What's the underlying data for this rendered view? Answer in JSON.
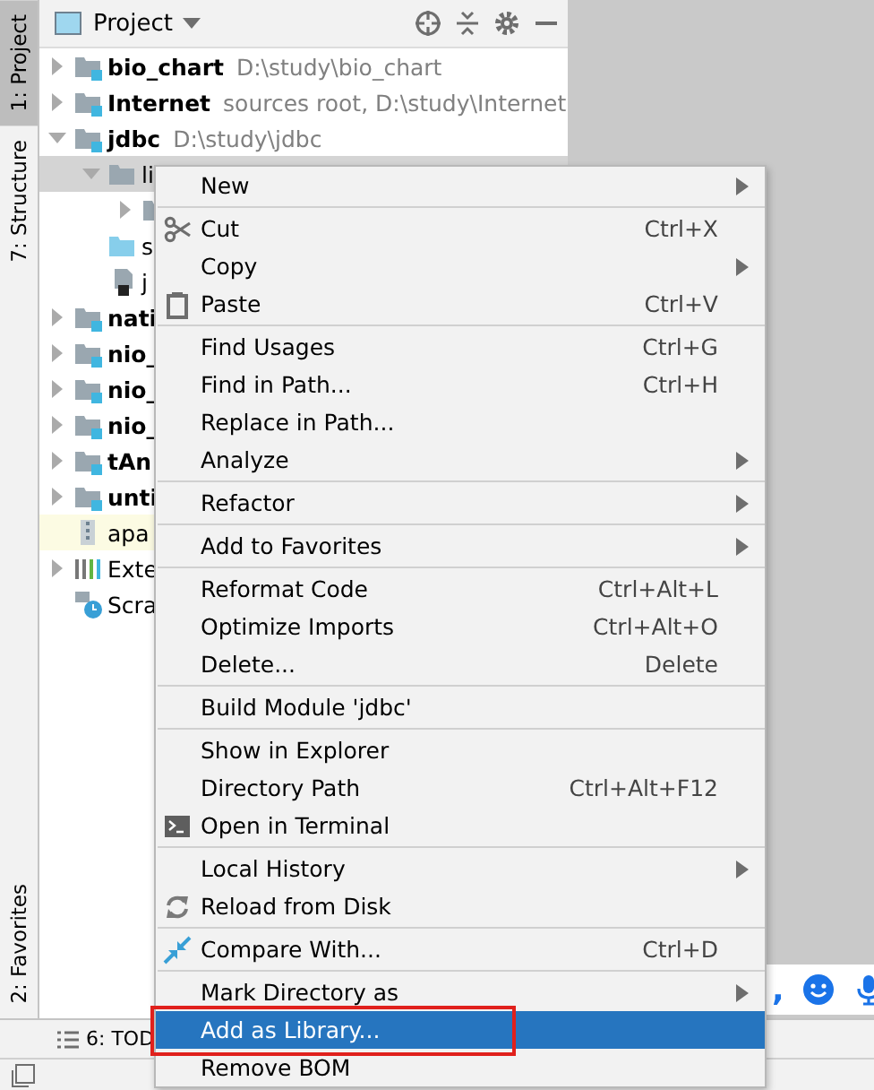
{
  "tool_strip": {
    "top_tabs": [
      {
        "label": "1: Project",
        "selected": true
      },
      {
        "label": "7: Structure",
        "selected": false
      }
    ],
    "bottom_tabs": [
      {
        "label": "2: Favorites",
        "selected": false
      }
    ]
  },
  "project_panel": {
    "title": "Project",
    "tree": [
      {
        "label": "bio_chart",
        "note": "D:\\study\\bio_chart",
        "kind": "module",
        "expanded": false,
        "selected": false,
        "highlighted": false
      },
      {
        "label": "Internet",
        "note": "sources root,  D:\\study\\Internet",
        "kind": "module",
        "expanded": false,
        "selected": false,
        "highlighted": false
      },
      {
        "label": "jdbc",
        "note": "D:\\study\\jdbc",
        "kind": "module",
        "expanded": true,
        "selected": false,
        "highlighted": false,
        "children": [
          {
            "label": "li",
            "kind": "folder",
            "expanded": true,
            "selected": true,
            "highlighted": false,
            "children": [
              {
                "kind": "folder",
                "expanded": false,
                "selected": false,
                "highlighted": false
              }
            ]
          },
          {
            "label": "s",
            "kind": "source-folder",
            "selected": false,
            "highlighted": false
          },
          {
            "label": "j",
            "kind": "iml-file",
            "selected": false,
            "highlighted": false
          }
        ]
      },
      {
        "label": "nati",
        "kind": "module",
        "expanded": false,
        "selected": false,
        "highlighted": false
      },
      {
        "label": "nio_",
        "kind": "module",
        "expanded": false,
        "selected": false,
        "highlighted": false
      },
      {
        "label": "nio_",
        "kind": "module",
        "expanded": false,
        "selected": false,
        "highlighted": false
      },
      {
        "label": "nio_",
        "kind": "module",
        "expanded": false,
        "selected": false,
        "highlighted": false
      },
      {
        "label": "tAn",
        "kind": "module",
        "expanded": false,
        "selected": false,
        "highlighted": false
      },
      {
        "label": "unti",
        "kind": "module",
        "expanded": false,
        "selected": false,
        "highlighted": false
      },
      {
        "label": "apa",
        "kind": "jar",
        "selected": false,
        "highlighted": true
      },
      {
        "label": "Exte",
        "kind": "libraries",
        "expanded": false,
        "selected": false,
        "highlighted": false
      },
      {
        "label": "Scra",
        "kind": "scratches",
        "selected": false,
        "highlighted": false
      }
    ]
  },
  "chat_bar": {
    "text": ","
  },
  "bottom_bar": {
    "tabs": [
      {
        "label": "6: TOD",
        "selected": false
      }
    ]
  },
  "context_menu": {
    "groups": [
      [
        {
          "label": "New",
          "kind": "plain",
          "submenu": true,
          "selected": false,
          "annotated": false
        }
      ],
      [
        {
          "label": "Cut",
          "kind": "cut",
          "shortcut": "Ctrl+X",
          "submenu": false,
          "selected": false,
          "annotated": false
        },
        {
          "label": "Copy",
          "kind": "plain",
          "submenu": true,
          "selected": false,
          "annotated": false
        },
        {
          "label": "Paste",
          "kind": "paste",
          "shortcut": "Ctrl+V",
          "submenu": false,
          "selected": false,
          "annotated": false
        }
      ],
      [
        {
          "label": "Find Usages",
          "kind": "plain",
          "shortcut": "Ctrl+G",
          "submenu": false,
          "selected": false,
          "annotated": false
        },
        {
          "label": "Find in Path...",
          "kind": "plain",
          "shortcut": "Ctrl+H",
          "submenu": false,
          "selected": false,
          "annotated": false
        },
        {
          "label": "Replace in Path...",
          "kind": "plain",
          "submenu": false,
          "selected": false,
          "annotated": false
        },
        {
          "label": "Analyze",
          "kind": "plain",
          "submenu": true,
          "selected": false,
          "annotated": false
        }
      ],
      [
        {
          "label": "Refactor",
          "kind": "plain",
          "submenu": true,
          "selected": false,
          "annotated": false
        }
      ],
      [
        {
          "label": "Add to Favorites",
          "kind": "plain",
          "submenu": true,
          "selected": false,
          "annotated": false
        }
      ],
      [
        {
          "label": "Reformat Code",
          "kind": "plain",
          "shortcut": "Ctrl+Alt+L",
          "submenu": false,
          "selected": false,
          "annotated": false
        },
        {
          "label": "Optimize Imports",
          "kind": "plain",
          "shortcut": "Ctrl+Alt+O",
          "submenu": false,
          "selected": false,
          "annotated": false
        },
        {
          "label": "Delete...",
          "kind": "plain",
          "shortcut": "Delete",
          "submenu": false,
          "selected": false,
          "annotated": false
        }
      ],
      [
        {
          "label": "Build Module 'jdbc'",
          "kind": "plain",
          "submenu": false,
          "selected": false,
          "annotated": false
        }
      ],
      [
        {
          "label": "Show in Explorer",
          "kind": "plain",
          "submenu": false,
          "selected": false,
          "annotated": false
        },
        {
          "label": "Directory Path",
          "kind": "plain",
          "shortcut": "Ctrl+Alt+F12",
          "submenu": false,
          "selected": false,
          "annotated": false
        },
        {
          "label": "Open in Terminal",
          "kind": "terminal",
          "submenu": false,
          "selected": false,
          "annotated": false
        }
      ],
      [
        {
          "label": "Local History",
          "kind": "plain",
          "submenu": true,
          "selected": false,
          "annotated": false
        },
        {
          "label": "Reload from Disk",
          "kind": "reload",
          "submenu": false,
          "selected": false,
          "annotated": false
        }
      ],
      [
        {
          "label": "Compare With...",
          "kind": "compare",
          "shortcut": "Ctrl+D",
          "submenu": false,
          "selected": false,
          "annotated": false
        }
      ],
      [
        {
          "label": "Mark Directory as",
          "kind": "plain",
          "submenu": true,
          "selected": false,
          "annotated": false
        },
        {
          "label": "Add as Library...",
          "kind": "plain",
          "submenu": false,
          "selected": true,
          "annotated": true
        },
        {
          "label": "Remove BOM",
          "kind": "plain",
          "submenu": false,
          "selected": false,
          "annotated": false
        }
      ]
    ]
  }
}
